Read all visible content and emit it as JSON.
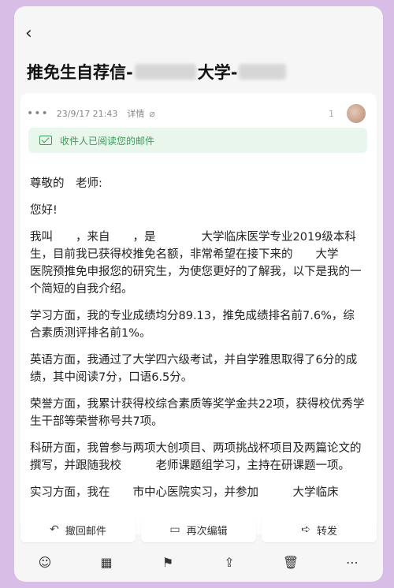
{
  "header": {
    "back_icon": "chevron-left-icon",
    "subject_prefix": "推免生自荐信-",
    "subject_mid": "大学-"
  },
  "meta": {
    "time": "23/9/17 21:43",
    "detail_label": "详情",
    "sender_partial": "1"
  },
  "read_notice": "收件人已阅读您的邮件",
  "body": [
    "尊敬的　老师:",
    "您好!",
    "我叫　　，来自　　，是　　　　大学临床医学专业2019级本科生，目前我已获得校推免名额，非常希望在接下来的　　大学　　医院预推免申报您的研究生，为使您更好的了解我，以下是我的一个简短的自我介绍。",
    "学习方面，我的专业成绩均分89.13，推免成绩排名前7.6%，综合素质测评排名前1%。",
    "英语方面，我通过了大学四六级考试，并自学雅思取得了6分的成绩，其中阅读7分，口语6.5分。",
    "荣誉方面，我累计获得校综合素质等奖学金共22项，获得校优秀学生干部等荣誉称号共7项。",
    "科研方面，我曾参与两项大创项目、两项挑战杯项目及两篇论文的撰写，并跟随我校　　　老师课题组学习，主持在研课题一项。",
    "实习方面，我在　　市中心医院实习，并参加　　　大学临床"
  ],
  "actions": [
    {
      "label": "撤回邮件",
      "icon": "undo-icon"
    },
    {
      "label": "再次编辑",
      "icon": "edit-icon"
    },
    {
      "label": "转发",
      "icon": "forward-icon"
    }
  ],
  "toolbar_icons": [
    "emoji-icon",
    "calendar-add-icon",
    "flag-icon",
    "move-folder-icon",
    "trash-icon",
    "more-icon"
  ]
}
